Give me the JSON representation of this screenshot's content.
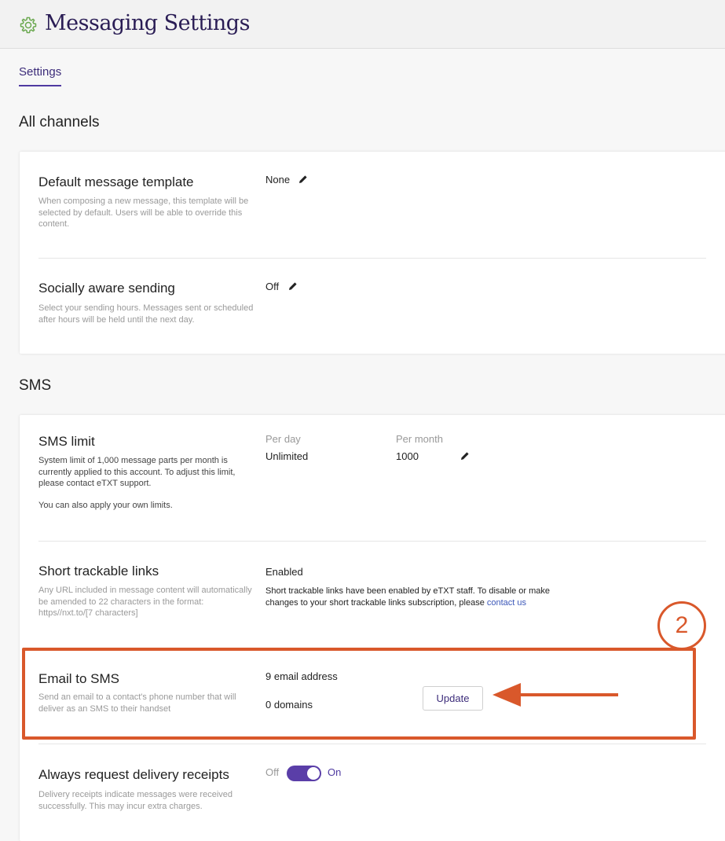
{
  "header": {
    "title": "Messaging Settings",
    "icon": "gear-icon"
  },
  "tabs": [
    {
      "label": "Settings",
      "active": true
    }
  ],
  "sections": {
    "all_channels": {
      "title": "All channels",
      "rows": {
        "default_template": {
          "title": "Default message template",
          "description": "When composing a new message, this template will be selected by default. Users will be able to override this content.",
          "value": "None"
        },
        "socially_aware": {
          "title": "Socially aware sending",
          "description": "Select your sending hours. Messages sent or scheduled after hours will be held until the next day.",
          "value": "Off"
        }
      }
    },
    "sms": {
      "title": "SMS",
      "rows": {
        "sms_limit": {
          "title": "SMS limit",
          "description": "System limit of 1,000 message parts per month is currently applied to this account. To adjust this limit, please contact eTXT support.",
          "description2": "You can also apply your own limits.",
          "per_day_label": "Per day",
          "per_day_value": "Unlimited",
          "per_month_label": "Per month",
          "per_month_value": "1000"
        },
        "short_links": {
          "title": "Short trackable links",
          "description": "Any URL included in message content will automatically be amended to 22 characters in the format: https//nxt.to/[7 characters]",
          "status": "Enabled",
          "note": "Short trackable links have been enabled by eTXT staff. To disable or make changes to your short trackable links subscription, please",
          "link": "contact us"
        },
        "email_to_sms": {
          "title": "Email to SMS",
          "description": "Send an email to a contact's phone number that will deliver as an SMS to their handset",
          "email_count": "9 email address",
          "domain_count": "0 domains",
          "button": "Update"
        },
        "delivery_receipts": {
          "title": "Always request delivery receipts",
          "description": "Delivery receipts indicate messages were received successfully. This may incur extra charges.",
          "off_label": "Off",
          "on_label": "On",
          "enabled": true
        }
      }
    }
  },
  "annotation": {
    "callout_number": "2",
    "color": "#d9582b"
  },
  "colors": {
    "brand": "#2a1d55",
    "accent": "#5a3ea8",
    "link": "#3a56b8",
    "icon_green": "#6aa84f"
  }
}
